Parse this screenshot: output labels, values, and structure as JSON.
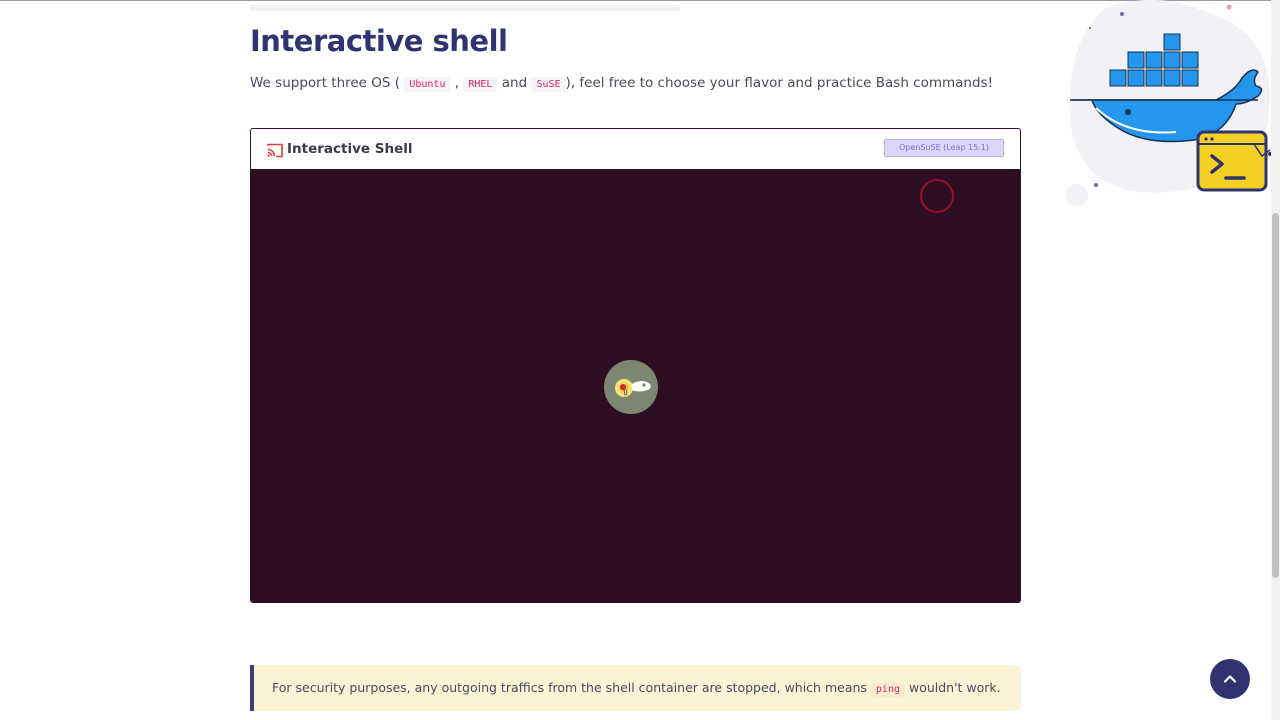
{
  "page": {
    "title": "Interactive shell",
    "intro": {
      "prefix": "We support three OS (",
      "os1": "Ubuntu",
      "sep1": ",",
      "os2": "RHEL",
      "sep2": "and",
      "os3": "SuSE",
      "suffix": "), feel free to choose your flavor and practice Bash commands!"
    }
  },
  "shell": {
    "header_title": "Interactive Shell",
    "os_selected": "OpenSuSE (Leap 15.1)",
    "icons": {
      "cast": "cast-icon",
      "loading": "opensuse-chameleon-loading-icon",
      "ring": "loading-ring-icon"
    }
  },
  "note": {
    "prefix": "For security purposes, any outgoing traffics from the shell container are stopped, which means",
    "code": "ping",
    "suffix": "wouldn't work."
  },
  "hero": {
    "illustration": "docker-whale-terminal-icon",
    "prompt_glyph": ">_"
  },
  "back_to_top": {
    "icon": "chevron-up-icon"
  },
  "colors": {
    "title": "#2f3470",
    "terminal_bg": "#2c0d22",
    "select_bg": "#dcd6fb",
    "note_bg": "#fcf3d6",
    "code_text": "#e0245e",
    "docker_blue": "#2496ed",
    "terminal_yellow": "#f2d024"
  }
}
